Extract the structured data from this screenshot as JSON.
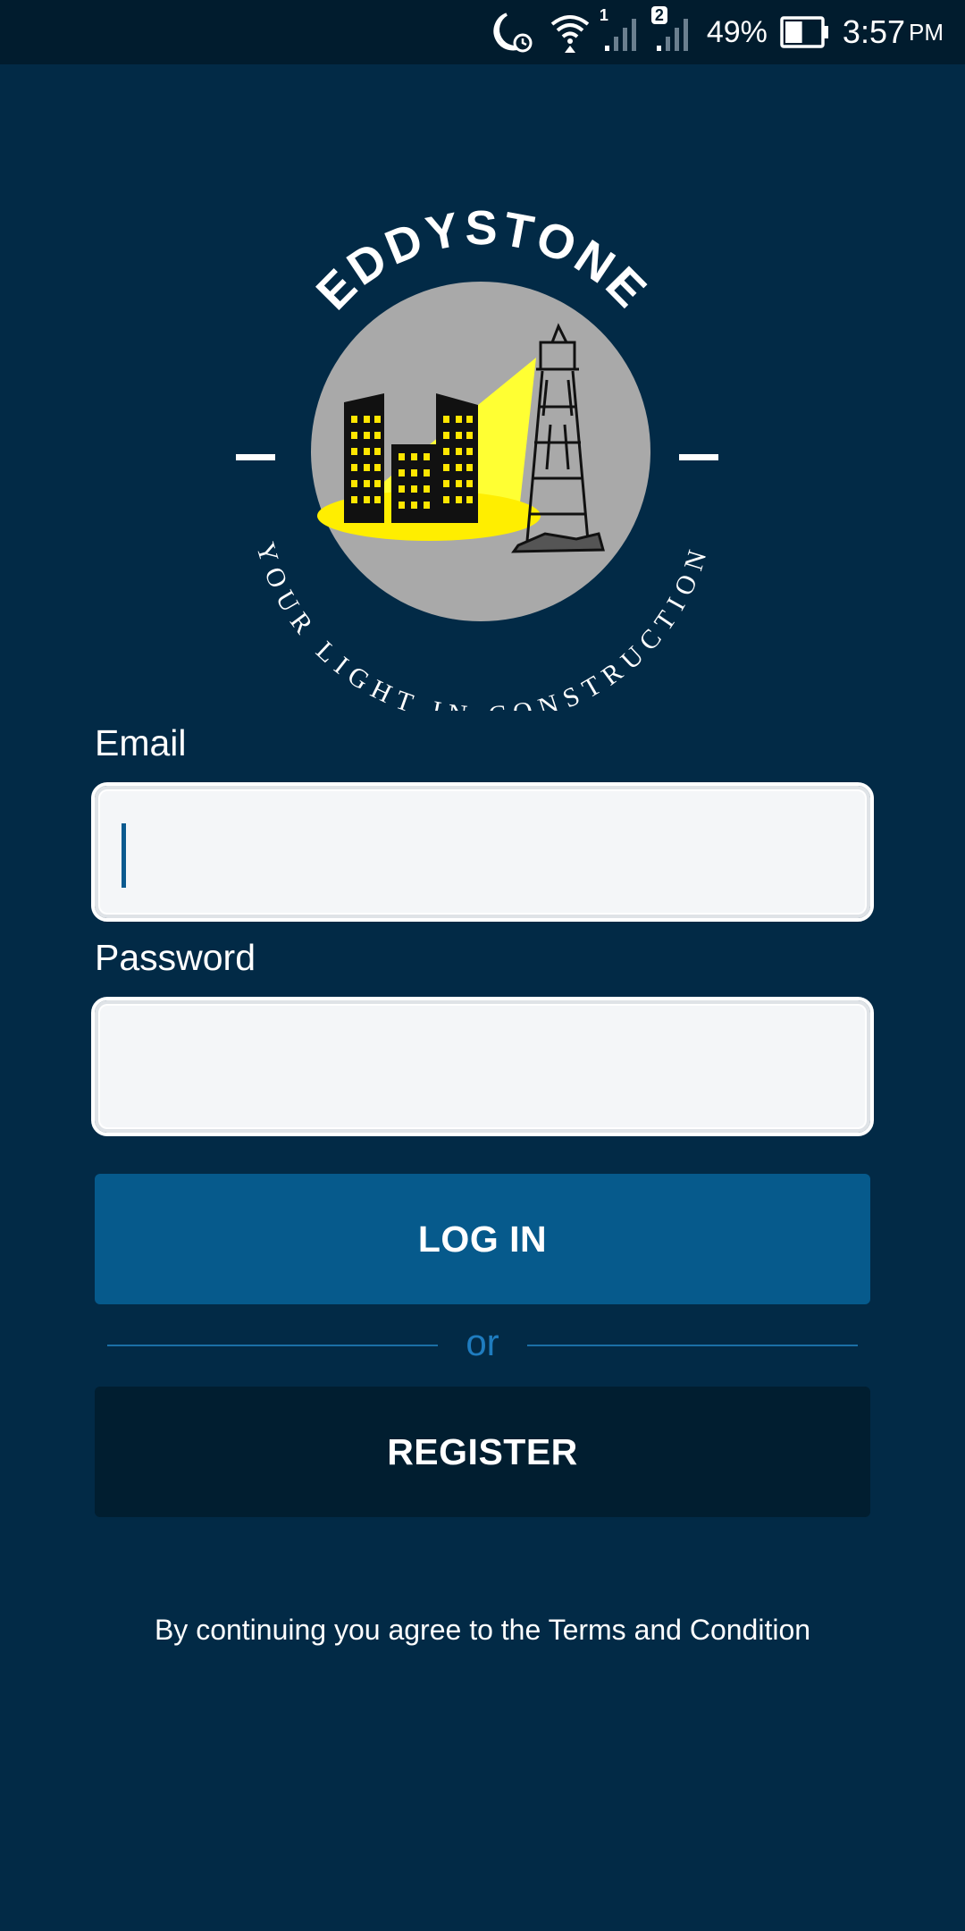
{
  "status_bar": {
    "sim1_label": "1",
    "sim2_label": "2",
    "battery_percent": "49%",
    "battery_level": 0.49,
    "time": "3:57",
    "ampm": "PM",
    "icons": [
      "moon-alarm-icon",
      "wifi-icon",
      "signal-icon",
      "signal-icon",
      "battery-icon"
    ]
  },
  "logo": {
    "brand": "EDDYSTONE",
    "tagline": "YOUR LIGHT IN CONSTRUCTION"
  },
  "form": {
    "email_label": "Email",
    "email_value": "",
    "password_label": "Password",
    "password_value": ""
  },
  "actions": {
    "login_label": "LOG IN",
    "divider_text": "or",
    "register_label": "REGISTER"
  },
  "footer": {
    "terms_text": "By continuing you agree to the Terms and Condition"
  },
  "colors": {
    "background": "#022a46",
    "status_bar": "#011c2e",
    "login_button": "#065a8c",
    "register_button": "#011e30",
    "accent": "#1f7cbf"
  }
}
